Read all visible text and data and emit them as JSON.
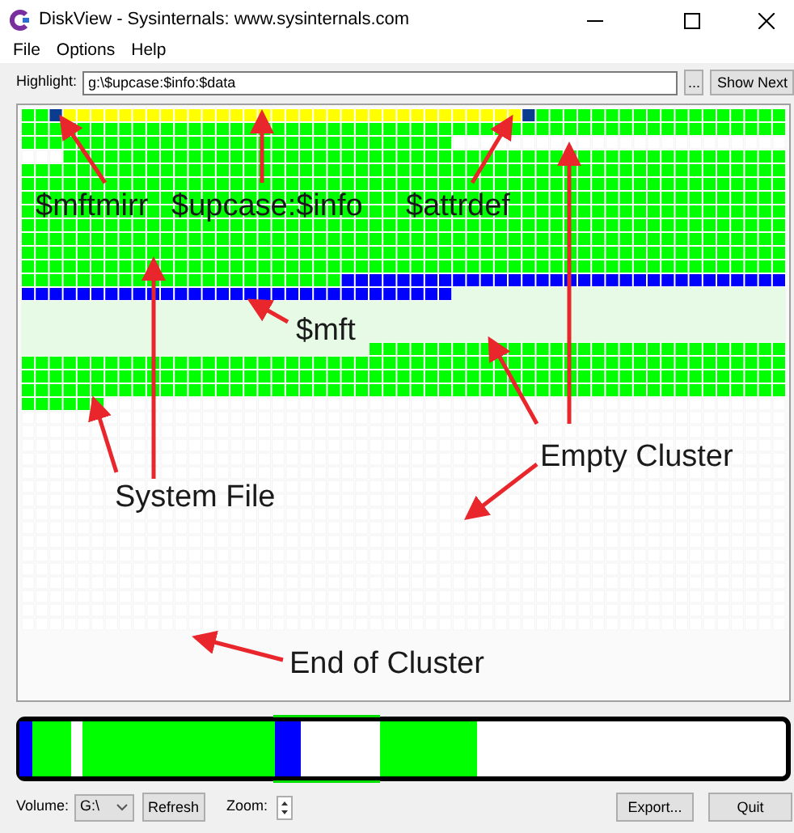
{
  "window": {
    "title": "DiskView - Sysinternals: www.sysinternals.com"
  },
  "menu": [
    "File",
    "Options",
    "Help"
  ],
  "highlight": {
    "label": "Highlight:",
    "value": "g:\\$upcase:$info:$data",
    "browse_button": "...",
    "show_next_button": "Show Next"
  },
  "annotations": [
    {
      "text": "$mftmirr"
    },
    {
      "text": "$upcase:$info"
    },
    {
      "text": "$attrdef"
    },
    {
      "text": "$mft"
    },
    {
      "text": "Empty Cluster"
    },
    {
      "text": "System File"
    },
    {
      "text": "End of Cluster"
    }
  ],
  "footer": {
    "volume_label": "Volume:",
    "volume_value": "G:\\",
    "refresh_button": "Refresh",
    "zoom_label": "Zoom:",
    "export_button": "Export...",
    "quit_button": "Quit"
  }
}
